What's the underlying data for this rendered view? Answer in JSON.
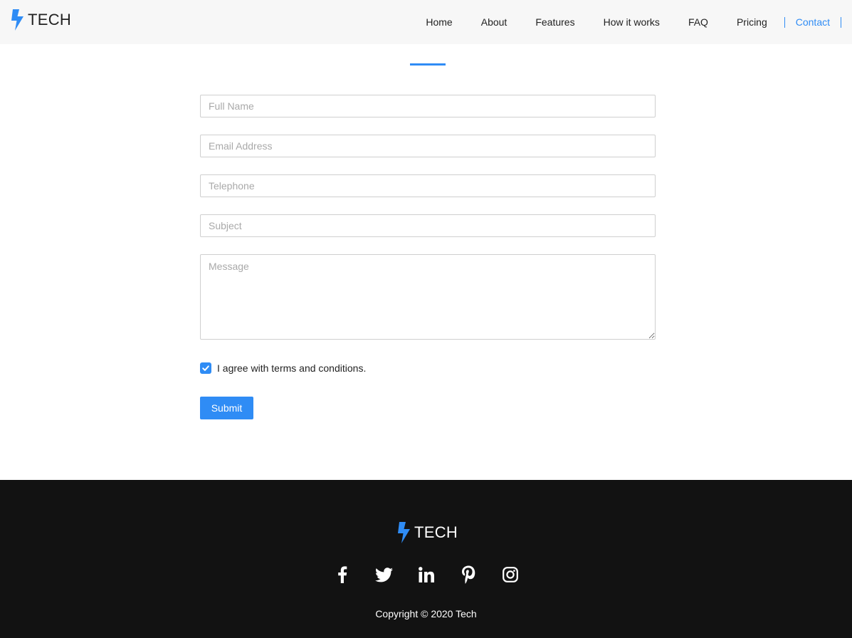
{
  "colors": {
    "accent": "#2f8cf5",
    "header_bg": "#f7f7f7",
    "footer_bg": "#121212"
  },
  "brand": {
    "name": "TECH",
    "icon": "lightning-bolt-icon"
  },
  "nav": {
    "items": [
      "Home",
      "About",
      "Features",
      "How it works",
      "FAQ",
      "Pricing"
    ],
    "active": "Contact"
  },
  "form": {
    "full_name_placeholder": "Full Name",
    "email_placeholder": "Email Address",
    "telephone_placeholder": "Telephone",
    "subject_placeholder": "Subject",
    "message_placeholder": "Message",
    "agree_label": "I agree with terms and conditions.",
    "agree_checked": true,
    "submit_label": "Submit"
  },
  "footer": {
    "brand": "TECH",
    "socials": [
      "facebook-icon",
      "twitter-icon",
      "linkedin-icon",
      "pinterest-icon",
      "instagram-icon"
    ],
    "copyright": "Copyright © 2020 Tech"
  }
}
